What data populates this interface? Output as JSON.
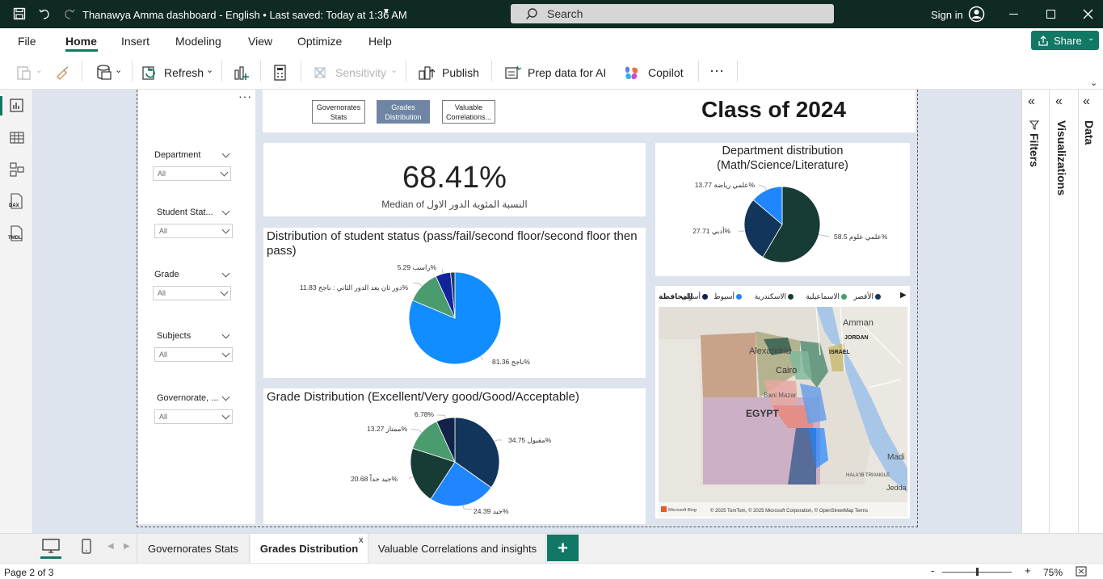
{
  "titlebar": {
    "title": "Thanawya Amma dashboard - English • Last saved: Today at 1:36 AM",
    "search_placeholder": "Search",
    "sign_in": "Sign in"
  },
  "menu": {
    "items": [
      "File",
      "Home",
      "Insert",
      "Modeling",
      "View",
      "Optimize",
      "Help"
    ],
    "active": "Home",
    "share": "Share"
  },
  "ribbon": {
    "refresh": "Refresh",
    "sensitivity": "Sensitivity",
    "publish": "Publish",
    "prep": "Prep data for AI",
    "copilot": "Copilot",
    "more": "···"
  },
  "leftrail": {
    "items": [
      "report-view",
      "table-view",
      "model-view",
      "DAX",
      "TMDL"
    ],
    "dax_label": "DAX",
    "tmdl_label": "TMDL"
  },
  "report": {
    "title": "Class of 2024",
    "nav_buttons": [
      "Governorates Stats",
      "Grades Distribution",
      "Valuable Correlations..."
    ],
    "nav_selected": 1,
    "slicer_dots": "···",
    "slicers": [
      {
        "label": "Department",
        "value": "All"
      },
      {
        "label": "Student Stat...",
        "value": "All"
      },
      {
        "label": "Grade",
        "value": "All"
      },
      {
        "label": "Subjects",
        "value": "All"
      },
      {
        "label": "Governorate, ...",
        "value": "All"
      }
    ],
    "kpi": {
      "value": "68.41%",
      "caption": "Median of النسبة المئوية الدور الاول"
    }
  },
  "chart_data": [
    {
      "type": "pie",
      "title": "Distribution of student status (pass/fail/second floor/second floor then pass)",
      "slices": [
        {
          "label": "ناجح",
          "value": 81.36,
          "text": "ناجح 81.36%",
          "color": "#118dff"
        },
        {
          "label": "دور ثان بعد الدور الثاني : ناجح",
          "value": 11.83,
          "text": "دور ثان بعد الدور الثاني : ناجح 11.83%",
          "color": "#4a9b6e"
        },
        {
          "label": "راسب",
          "value": 5.29,
          "text": "راسب 5.29%",
          "color": "#12239e"
        },
        {
          "label": "other",
          "value": 1.52,
          "text": "",
          "color": "#1a3d6b"
        }
      ]
    },
    {
      "type": "pie",
      "title": "Grade Distribution (Excellent/Very good/Good/Acceptable)",
      "slices": [
        {
          "label": "مقبول",
          "value": 34.75,
          "text": "مقبول 34.75%",
          "color": "#12355b"
        },
        {
          "label": "جيد",
          "value": 24.39,
          "text": "جيد 24.39%",
          "color": "#1f86ff"
        },
        {
          "label": "جيد جداً",
          "value": 20.68,
          "text": "جيد جداً 20.68%",
          "color": "#173b35"
        },
        {
          "label": "ممتاز",
          "value": 13.27,
          "text": "ممتاز 13.27%",
          "color": "#4a9b6e"
        },
        {
          "label": "",
          "value": 6.78,
          "text": "6.78%",
          "color": "#12234a"
        }
      ]
    },
    {
      "type": "pie",
      "title": "Department distribution (Math/Science/Literature)",
      "slices": [
        {
          "label": "علمي علوم",
          "value": 58.5,
          "text": "علمي علوم 58.5%",
          "color": "#173b35"
        },
        {
          "label": "أدبي",
          "value": 27.71,
          "text": "أدبي 27.71%",
          "color": "#12355b"
        },
        {
          "label": "علمي رياضة",
          "value": 13.77,
          "text": "علمي رياضة 13.77%",
          "color": "#1f86ff"
        }
      ]
    }
  ],
  "map": {
    "legend_title": "المحافظة",
    "legend": [
      {
        "name": "الأقصر",
        "color": "#12355b"
      },
      {
        "name": "الاسماعيلية",
        "color": "#4a9b6e"
      },
      {
        "name": "الاسكندرية",
        "color": "#173b35"
      },
      {
        "name": "أسيوط",
        "color": "#1f86ff"
      },
      {
        "name": "أسوان",
        "color": "#12234a"
      }
    ],
    "places": [
      "Amman",
      "JORDAN",
      "ISRAEL",
      "Alexandria",
      "Cairo",
      "Bani Mazar",
      "EGYPT",
      "Madi",
      "HALA'IB TRIANGLE",
      "Jedda"
    ],
    "attribution": "© 2025 TomTom, © 2025 Microsoft Corporation, © OpenStreetMap  Terms",
    "bing": "Microsoft Bing"
  },
  "tabs": {
    "items": [
      "Governorates Stats",
      "Grades Distribution",
      "Valuable Correlations and insights"
    ],
    "active": 1,
    "close": "x",
    "add": "+"
  },
  "rightpanes": {
    "filters": "Filters",
    "visualizations": "Visualizations",
    "data": "Data"
  },
  "status": {
    "page": "Page 2 of 3",
    "zoom": "75%",
    "zoom_fraction": 0.5
  }
}
